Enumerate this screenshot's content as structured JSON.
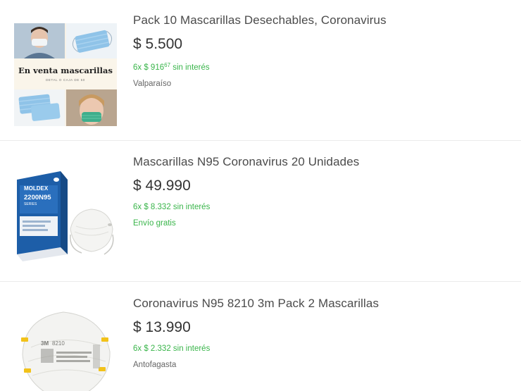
{
  "items": [
    {
      "title": "Pack 10 Mascarillas Desechables, Coronavirus",
      "price": "$ 5.500",
      "installments_main": "6x $ 916",
      "installments_cents": "67",
      "installments_suffix": " sin interés",
      "location": "Valparaíso",
      "image_text": {
        "headline": "En venta mascarillas",
        "subline": "DETAL O CAJA DE 50"
      }
    },
    {
      "title": "Mascarillas N95 Coronavirus 20 Unidades",
      "price": "$ 49.990",
      "installments": "6x $ 8.332 sin interés",
      "shipping": "Envío gratis",
      "image_text": {
        "brand": "MOLDEX",
        "model": "2200N95",
        "series": "SERIES"
      }
    },
    {
      "title": "Coronavirus N95 8210 3m Pack 2 Mascarillas",
      "price": "$ 13.990",
      "installments": "6x $ 2.332 sin interés",
      "location": "Antofagasta",
      "image_text": {
        "brand": "3M",
        "model": "8210"
      }
    }
  ],
  "colors": {
    "green": "#39b54a",
    "title": "#4b4b4b",
    "price": "#333333",
    "divider": "#ebebeb"
  }
}
